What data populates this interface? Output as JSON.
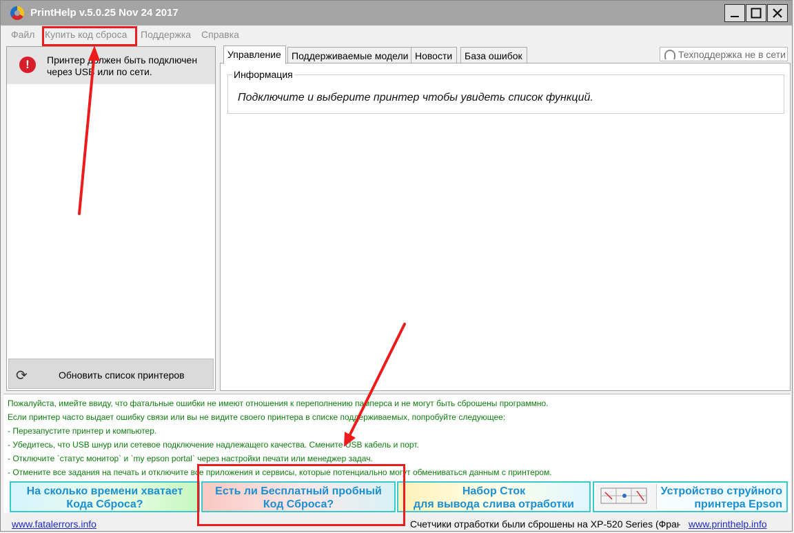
{
  "window": {
    "title": "PrintHelp v.5.0.25 Nov 24 2017",
    "controls": {
      "minimize": "—",
      "maximize": "☐",
      "close": "✕"
    }
  },
  "menu": [
    "Файл",
    "Купить код сброса",
    "Поддержка",
    "Справка"
  ],
  "left_panel": {
    "alert_icon": "!",
    "alert_text": "Принтер должен быть подключен через USB или по сети.",
    "refresh_icon": "⟳",
    "refresh_label": "Обновить список принтеров"
  },
  "tabs": [
    "Управление",
    "Поддерживаемые модели",
    "Новости",
    "База ошибок"
  ],
  "support_status": "Техподдержка не в сети",
  "info": {
    "legend": "Информация",
    "text": "Подключите и выберите принтер чтобы увидеть список функций."
  },
  "notes": [
    "Пожалуйста, имейте ввиду, что фатальные ошибки не имеют отношения к переполнению памперса и не могут быть сброшены программно.",
    "Если принтер часто выдает ошибку связи или вы не видите своего принтера в списке поддерживаемых, попробуйте следующее:",
    "- Перезапустите принтер и компьютер.",
    "- Убедитесь, что USB шнур или сетевое подключение надлежащего качества. Смените USB кабель и порт.",
    "- Отключите `статус монитор` и `my epson portal` через настройки печати или менеджер задач.",
    "- Отмените все задания на печать и отключите все приложения и сервисы, которые потенциально могут обмениваться данным с принтером."
  ],
  "banners": [
    {
      "line1": "На сколько времени хватает",
      "line2": "Кода Сброса?"
    },
    {
      "line1": "Есть ли Бесплатный пробный",
      "line2": "Код Сброса?"
    },
    {
      "line1": "Набор Сток",
      "line2": "для вывода слива отработки"
    },
    {
      "line1": "Устройство струйного",
      "line2": "принтера Epson"
    }
  ],
  "status": {
    "left_link": "www.fatalerrors.info",
    "message": "Счетчики отработки были сброшены на XP-520 Series (Фран",
    "right_link": "www.printhelp.info"
  },
  "colors": {
    "annotation": "#ed1c1c",
    "notes_text": "#0c7d0c",
    "banner_text": "#1b8fd0",
    "link": "#1e2ac8",
    "alert": "#d91e2b"
  }
}
